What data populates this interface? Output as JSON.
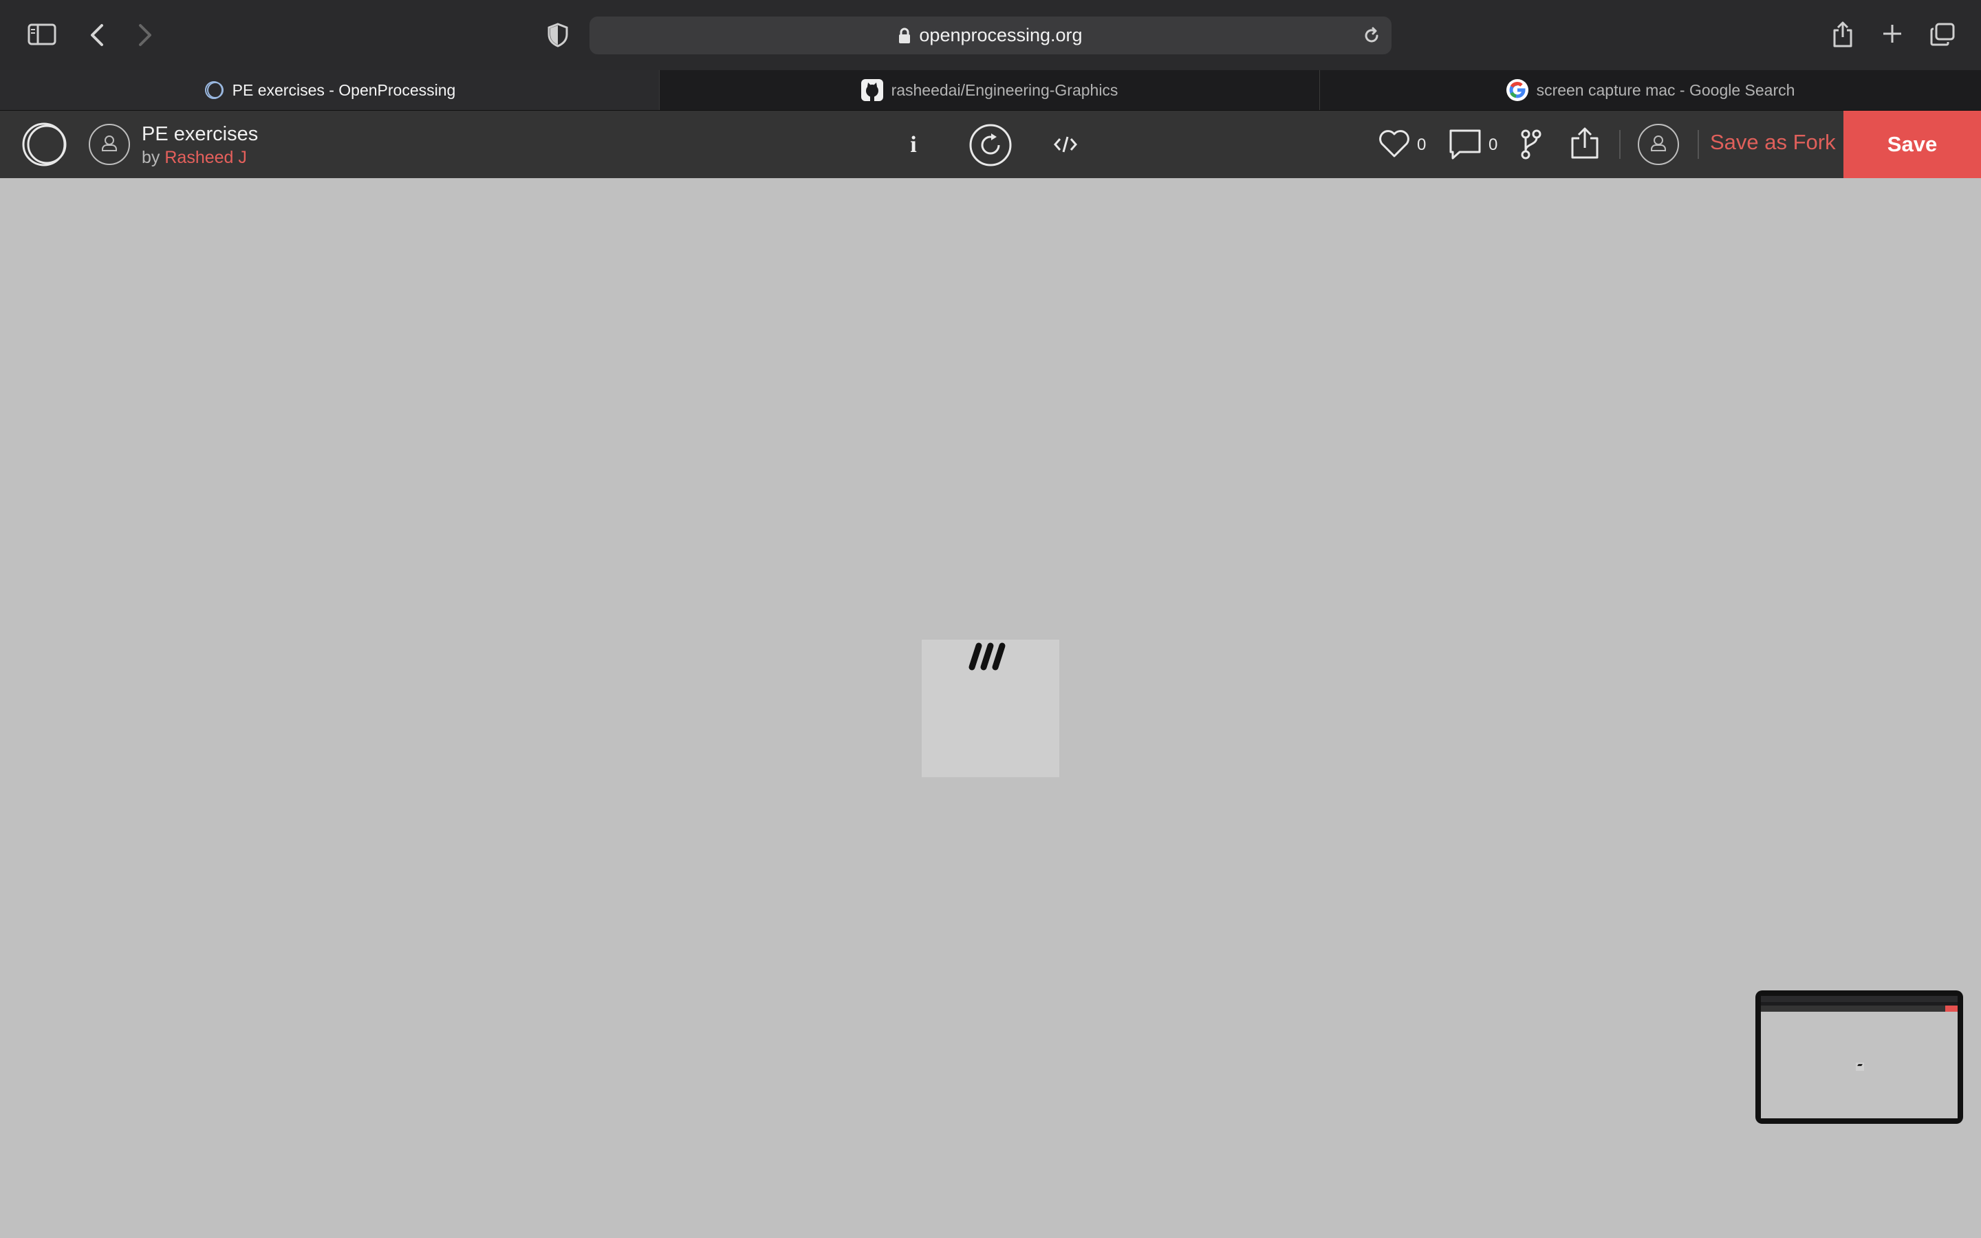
{
  "browser": {
    "url": "openprocessing.org",
    "icons": [
      "sidebar-icon",
      "back-icon",
      "forward-icon",
      "shield-icon",
      "lock-icon",
      "reload-icon",
      "share-icon",
      "new-tab-icon",
      "tab-overview-icon"
    ]
  },
  "tabs": [
    {
      "label": "PE exercises - OpenProcessing",
      "icon": "openprocessing-logo-icon",
      "active": true
    },
    {
      "label": "rasheedai/Engineering-Graphics",
      "icon": "github-icon",
      "active": false
    },
    {
      "label": "screen capture mac - Google Search",
      "icon": "google-icon",
      "active": false
    }
  ],
  "header": {
    "title": "PE exercises",
    "by_prefix": "by",
    "author": "Rasheed J",
    "likes": "0",
    "comments": "0",
    "info_label": "i",
    "save_as_fork": "Save as Fork",
    "save": "Save"
  },
  "colors": {
    "accent": "#e5514f",
    "author_link": "#e6605c",
    "canvas_bg": "#c0c0c0",
    "sketch_bg": "#cecece"
  }
}
